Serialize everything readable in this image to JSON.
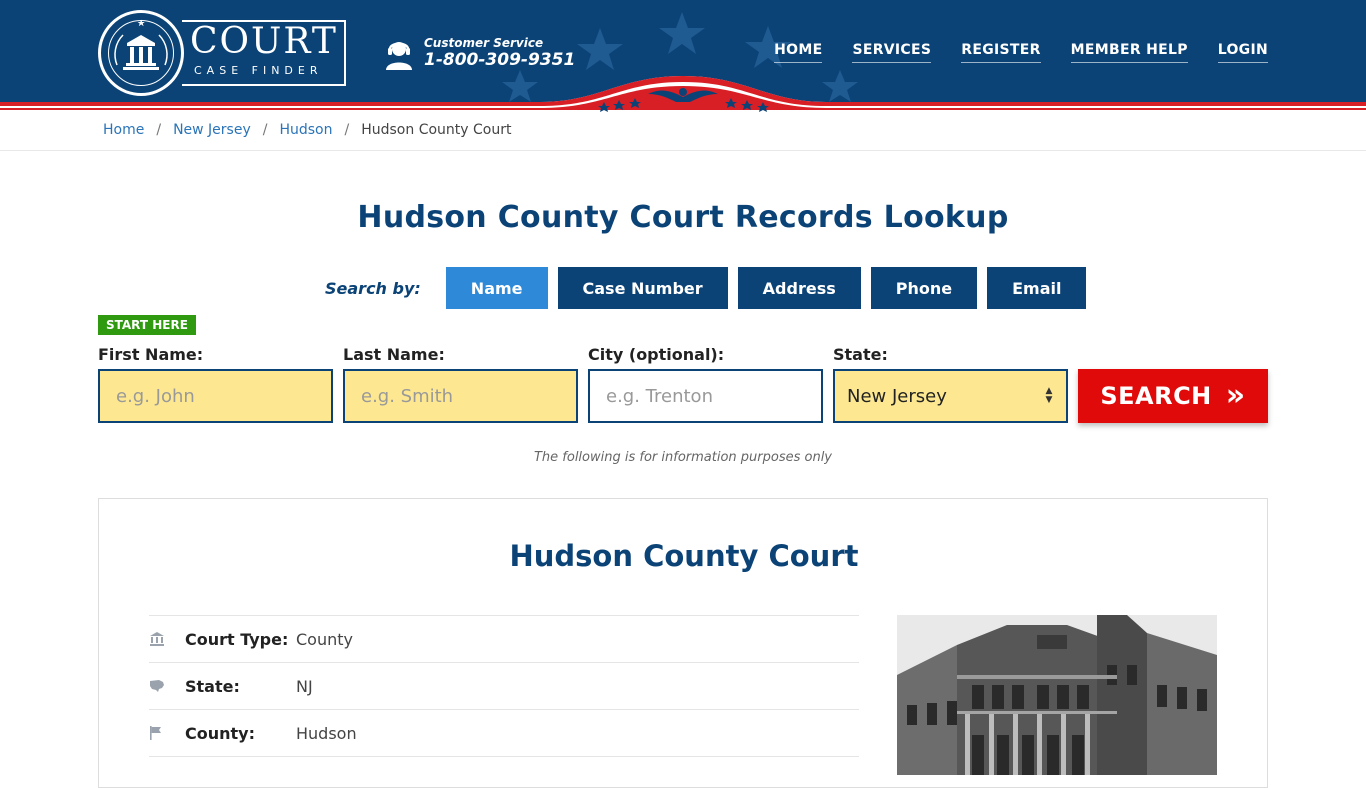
{
  "logo": {
    "word": "COURT",
    "sub": "CASE FINDER"
  },
  "customer_service": {
    "label": "Customer Service",
    "phone": "1-800-309-9351"
  },
  "nav": {
    "home": "HOME",
    "services": "SERVICES",
    "register": "REGISTER",
    "member_help": "MEMBER HELP",
    "login": "LOGIN"
  },
  "breadcrumb": {
    "home": "Home",
    "state": "New Jersey",
    "county": "Hudson",
    "current": "Hudson County Court",
    "sep": "/"
  },
  "title": "Hudson County Court Records Lookup",
  "search_by": {
    "label": "Search by:",
    "tabs": [
      "Name",
      "Case Number",
      "Address",
      "Phone",
      "Email"
    ]
  },
  "start_here": "START HERE",
  "form": {
    "first_name": {
      "label": "First Name:",
      "placeholder": "e.g. John"
    },
    "last_name": {
      "label": "Last Name:",
      "placeholder": "e.g. Smith"
    },
    "city": {
      "label": "City (optional):",
      "placeholder": "e.g.  Trenton"
    },
    "state": {
      "label": "State:",
      "value": "New Jersey"
    },
    "search_label": "SEARCH",
    "search_arrow": "»"
  },
  "info_note": "The following is for information purposes only",
  "court": {
    "title": "Hudson County Court",
    "rows": [
      {
        "key": "Court Type:",
        "value": "County",
        "icon": "courthouse-icon"
      },
      {
        "key": "State:",
        "value": "NJ",
        "icon": "usa-map-icon"
      },
      {
        "key": "County:",
        "value": "Hudson",
        "icon": "flag-icon"
      }
    ]
  },
  "colors": {
    "navy": "#0b4377",
    "active_tab": "#2e8ad8",
    "search_red": "#e00a0a",
    "start_green": "#2f9a10",
    "field_yellow": "#fde891"
  }
}
